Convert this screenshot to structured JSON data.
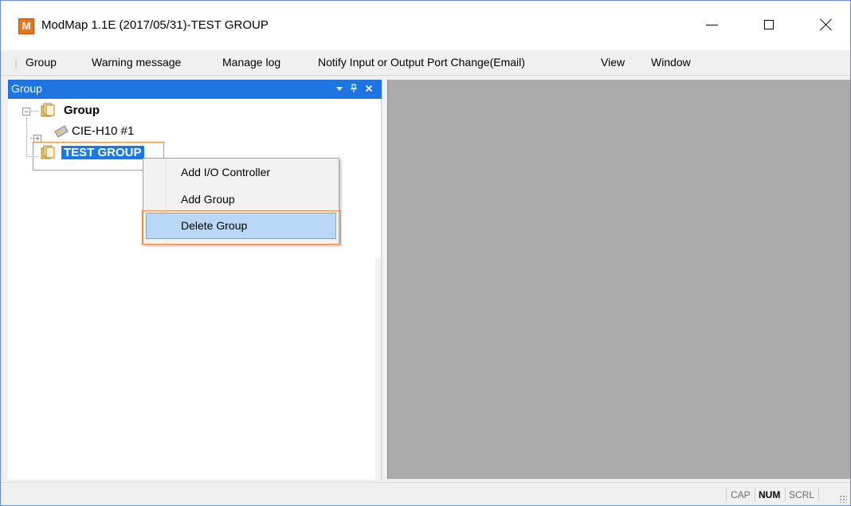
{
  "window": {
    "title": "ModMap 1.1E (2017/05/31)-TEST GROUP",
    "app_icon_letter": "M",
    "app_icon_color": "#e8741c"
  },
  "menubar": {
    "items": [
      {
        "label": "Group"
      },
      {
        "label": "Warning message"
      },
      {
        "label": "Manage log"
      },
      {
        "label": "Notify Input or Output Port Change(Email)"
      },
      {
        "label": "View"
      },
      {
        "label": "Window"
      }
    ]
  },
  "panel": {
    "title": "Group",
    "header_color": "#1e74e0",
    "controls": {
      "dropdown": "▾",
      "pin": "ᵖ",
      "close": "✕"
    }
  },
  "tree": {
    "root": {
      "label": "Group",
      "expanded": true,
      "icon": "folder-icon"
    },
    "children": [
      {
        "label": "CIE-H10 #1",
        "expanded": false,
        "icon": "device-icon"
      },
      {
        "label": "TEST GROUP",
        "selected": true,
        "icon": "folder-icon"
      }
    ]
  },
  "context_menu": {
    "items": [
      {
        "label": "Add I/O Controller"
      },
      {
        "label": "Add Group"
      },
      {
        "label": "Delete Group",
        "highlighted": true
      }
    ]
  },
  "statusbar": {
    "indicators": [
      {
        "label": "CAP",
        "active": false
      },
      {
        "label": "NUM",
        "active": true
      },
      {
        "label": "SCRL",
        "active": false
      }
    ]
  },
  "colors": {
    "selection": "#1979e6",
    "highlight_outline": "#ef8a3c",
    "mdi_background": "#ababab"
  }
}
